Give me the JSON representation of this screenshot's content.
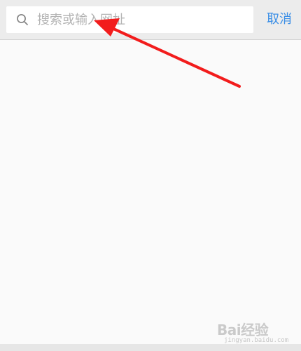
{
  "search": {
    "placeholder": "搜索或输入网址",
    "value": ""
  },
  "cancel_label": "取消",
  "icons": {
    "search": "search-icon",
    "annotation": "red-arrow-annotation"
  },
  "watermark": {
    "logo": "Bai经验",
    "url": "jingyan.baidu.com"
  },
  "colors": {
    "accent": "#3a8ee6",
    "top_bar": "#ececec",
    "background": "#fafafa",
    "placeholder": "#b3b3b3",
    "arrow": "#f21c1c"
  }
}
